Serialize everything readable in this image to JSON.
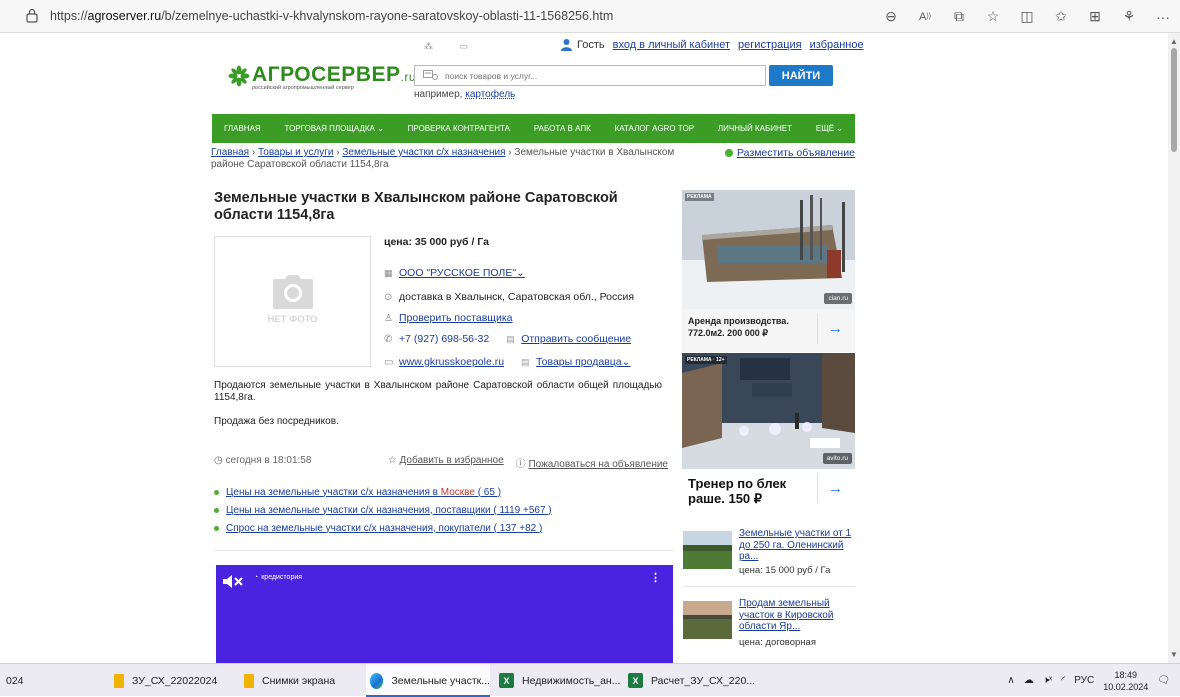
{
  "browser": {
    "url_prefix": "https://",
    "url_host": "agroserver.ru",
    "url_path": "/b/zemelnye-uchastki-v-khvalynskom-rayone-saratovskoy-oblasti-11-1568256.htm"
  },
  "header": {
    "guest": "Гость",
    "login": "вход в личный кабинет",
    "register": "регистрация",
    "favorites": "избранное",
    "logo_main": "АГРОСЕРВЕР",
    "logo_tld": ".ru",
    "logo_tagline": "российский агропромышленный сервер",
    "search_placeholder": "поиск товаров и услуг...",
    "search_button": "НАЙТИ",
    "example_prefix": "например,",
    "example_link": "картофель"
  },
  "nav": [
    "ГЛАВНАЯ",
    "ТОРГОВАЯ ПЛОЩАДКА ⌄",
    "ПРОВЕРКА КОНТРАГЕНТА",
    "РАБОТА В АПК",
    "КАТАЛОГ AGRO TOP",
    "ЛИЧНЫЙ КАБИНЕТ",
    "ЕЩЁ ⌄"
  ],
  "breadcrumb": {
    "home": "Главная",
    "goods": "Товары и услуги",
    "category": "Земельные участки с/х назначения",
    "current": "Земельные участки в Хвалынском районе Саратовской области 1154,8га",
    "post_ad": "Разместить объявление"
  },
  "listing": {
    "title": "Земельные участки в Хвалынском районе Саратовской области 1154,8га",
    "no_photo": "НЕТ ФОТО",
    "price": "цена: 35 000 руб / Га",
    "company": "ООО \"РУССКОЕ ПОЛЕ\"⌄",
    "delivery": "доставка в Хвалынск, Саратовская обл., Россия",
    "check_supplier": "Проверить поставщика",
    "phone": "+7 (927) 698-56-32",
    "send_message": "Отправить сообщение",
    "website": "www.gkrusskoepole.ru",
    "seller_goods": "Товары продавца⌄",
    "description": "Продаются земельные участки в Хвалынском районе Саратовской области общей площадью 1154,8га.",
    "description2": "Продажа без посредников.",
    "posted": "сегодня в 18:01:58",
    "add_favorite": "Добавить в избранное",
    "complain": "Пожаловаться на объявление"
  },
  "price_links": [
    {
      "text": "Цены на земельные участки с/х назначения в ",
      "city": "Москве",
      "suffix": " ( 65 )"
    },
    {
      "text": "Цены на земельные участки с/х назначения, поставщики ( 1119 +567 )"
    },
    {
      "text": "Спрос на земельные участки с/х назначения, покупатели ( 137 +82 )"
    }
  ],
  "video": {
    "brand": "кредистория"
  },
  "ads": [
    {
      "label": "РЕКЛАМА",
      "source": "cian.ru",
      "text": "Аренда производства. 772.0м2. 200 000 ₽"
    },
    {
      "label": "РЕКЛАМА · 12+",
      "source": "avito.ru",
      "text": "Тренер по блек раше. 150 ₽"
    }
  ],
  "side_items": [
    {
      "title": "Земельные участки от 1 до 250 га. Оленинский ра...",
      "price": "цена: 15 000 руб / Га"
    },
    {
      "title": "Продам земельный участок в Кировской области Яр...",
      "price": "цена: договорная"
    }
  ],
  "taskbar": {
    "items": [
      "024",
      "ЗУ_СХ_22022024",
      "Снимки экрана",
      "Земельные участк...",
      "Недвижимость_ан...",
      "Расчет_ЗУ_СХ_220..."
    ],
    "lang": "РУС",
    "time": "18:49",
    "date": "10.02.2024"
  }
}
